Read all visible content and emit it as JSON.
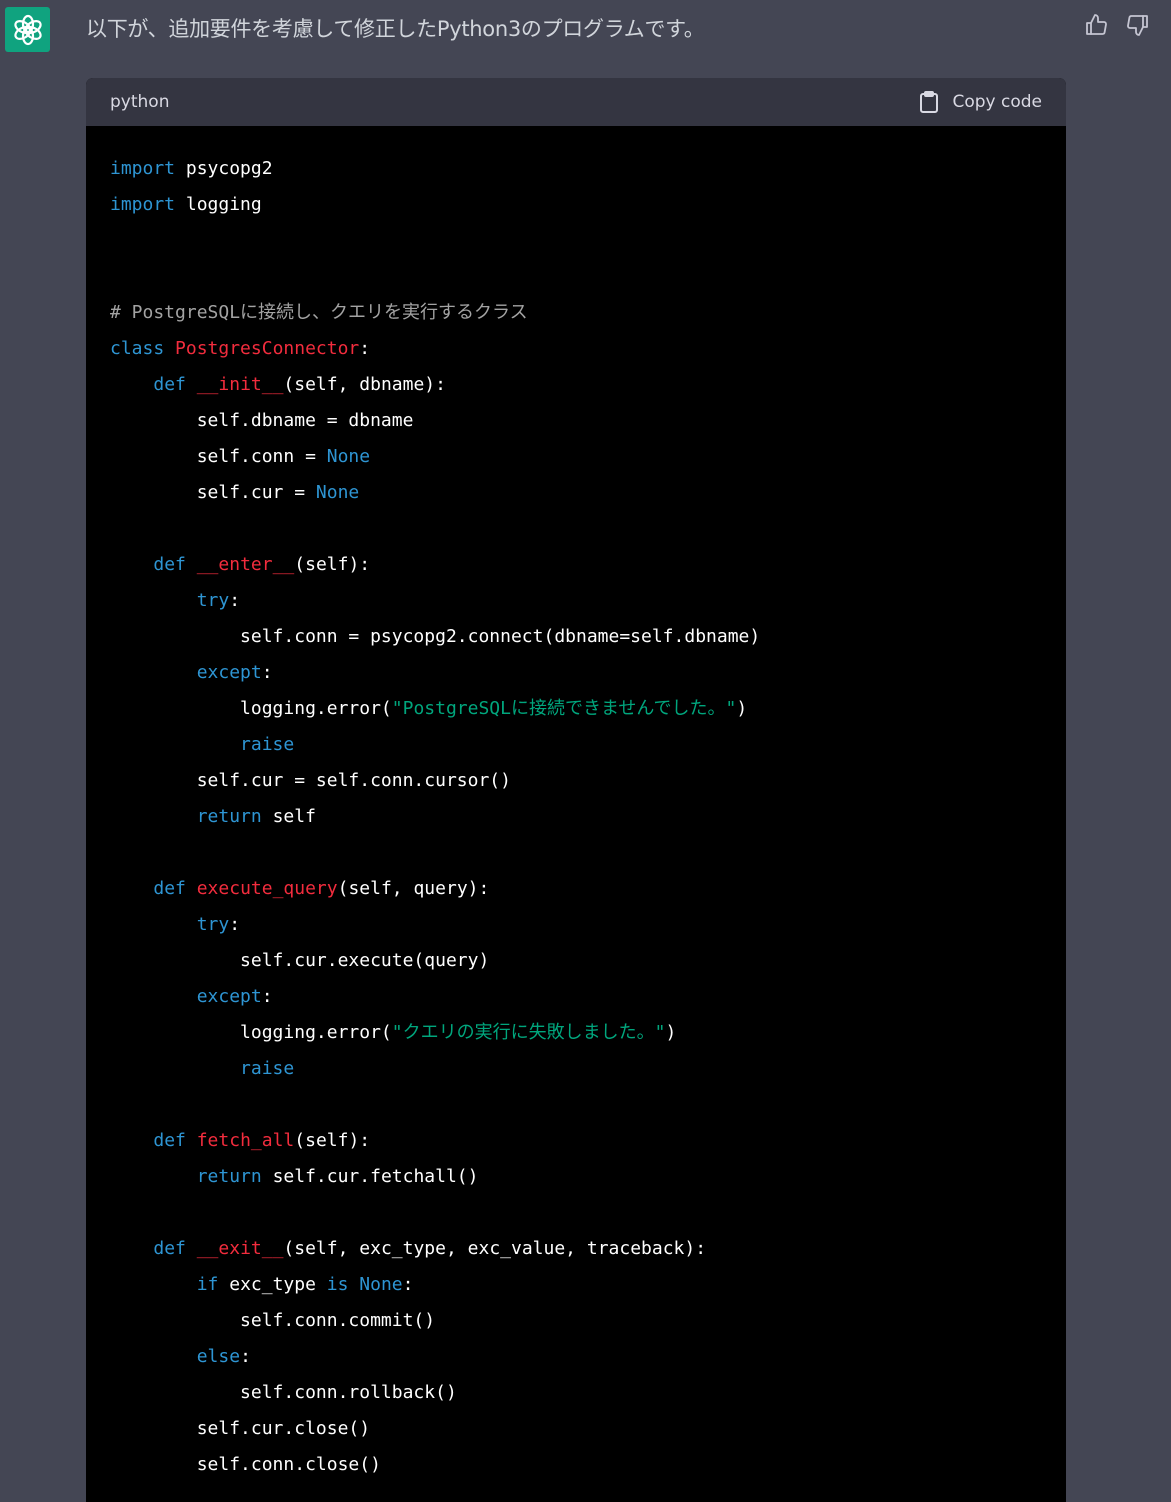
{
  "message": {
    "text": "以下が、追加要件を考慮して修正したPython3のプログラムです。"
  },
  "colors": {
    "background": "#444654",
    "avatar": "#10a37f",
    "code_header_bg": "#343541",
    "code_bg": "#000000",
    "keyword": "#2e95d3",
    "function": "#f22c3d",
    "string": "#00a67d",
    "comment": "#a3a3a3"
  },
  "icons": {
    "avatar": "openai-logo-icon",
    "thumbs_up": "thumbs-up-icon",
    "thumbs_down": "thumbs-down-icon",
    "copy": "clipboard-icon"
  },
  "code_block": {
    "language": "python",
    "copy_label": "Copy code",
    "lines": [
      [
        {
          "t": "import",
          "c": "kw"
        },
        {
          "t": " psycopg2"
        }
      ],
      [
        {
          "t": "import",
          "c": "kw"
        },
        {
          "t": " logging"
        }
      ],
      [],
      [],
      [
        {
          "t": "# PostgreSQLに接続し、クエリを実行するクラス",
          "c": "cm"
        }
      ],
      [
        {
          "t": "class",
          "c": "kw"
        },
        {
          "t": " "
        },
        {
          "t": "PostgresConnector",
          "c": "fn"
        },
        {
          "t": ":"
        }
      ],
      [
        {
          "t": "    "
        },
        {
          "t": "def",
          "c": "kw"
        },
        {
          "t": " "
        },
        {
          "t": "__init__",
          "c": "fn"
        },
        {
          "t": "(self, dbname):"
        }
      ],
      [
        {
          "t": "        self.dbname = dbname"
        }
      ],
      [
        {
          "t": "        self.conn = "
        },
        {
          "t": "None",
          "c": "kw"
        }
      ],
      [
        {
          "t": "        self.cur = "
        },
        {
          "t": "None",
          "c": "kw"
        }
      ],
      [],
      [
        {
          "t": "    "
        },
        {
          "t": "def",
          "c": "kw"
        },
        {
          "t": " "
        },
        {
          "t": "__enter__",
          "c": "fn"
        },
        {
          "t": "(self):"
        }
      ],
      [
        {
          "t": "        "
        },
        {
          "t": "try",
          "c": "kw"
        },
        {
          "t": ":"
        }
      ],
      [
        {
          "t": "            self.conn = psycopg2.connect(dbname=self.dbname)"
        }
      ],
      [
        {
          "t": "        "
        },
        {
          "t": "except",
          "c": "kw"
        },
        {
          "t": ":"
        }
      ],
      [
        {
          "t": "            logging.error("
        },
        {
          "t": "\"PostgreSQLに接続できませんでした。\"",
          "c": "str"
        },
        {
          "t": ")"
        }
      ],
      [
        {
          "t": "            "
        },
        {
          "t": "raise",
          "c": "kw"
        }
      ],
      [
        {
          "t": "        self.cur = self.conn.cursor()"
        }
      ],
      [
        {
          "t": "        "
        },
        {
          "t": "return",
          "c": "kw"
        },
        {
          "t": " self"
        }
      ],
      [],
      [
        {
          "t": "    "
        },
        {
          "t": "def",
          "c": "kw"
        },
        {
          "t": " "
        },
        {
          "t": "execute_query",
          "c": "fn"
        },
        {
          "t": "(self, query):"
        }
      ],
      [
        {
          "t": "        "
        },
        {
          "t": "try",
          "c": "kw"
        },
        {
          "t": ":"
        }
      ],
      [
        {
          "t": "            self.cur.execute(query)"
        }
      ],
      [
        {
          "t": "        "
        },
        {
          "t": "except",
          "c": "kw"
        },
        {
          "t": ":"
        }
      ],
      [
        {
          "t": "            logging.error("
        },
        {
          "t": "\"クエリの実行に失敗しました。\"",
          "c": "str"
        },
        {
          "t": ")"
        }
      ],
      [
        {
          "t": "            "
        },
        {
          "t": "raise",
          "c": "kw"
        }
      ],
      [],
      [
        {
          "t": "    "
        },
        {
          "t": "def",
          "c": "kw"
        },
        {
          "t": " "
        },
        {
          "t": "fetch_all",
          "c": "fn"
        },
        {
          "t": "(self):"
        }
      ],
      [
        {
          "t": "        "
        },
        {
          "t": "return",
          "c": "kw"
        },
        {
          "t": " self.cur.fetchall()"
        }
      ],
      [],
      [
        {
          "t": "    "
        },
        {
          "t": "def",
          "c": "kw"
        },
        {
          "t": " "
        },
        {
          "t": "__exit__",
          "c": "fn"
        },
        {
          "t": "(self, exc_type, exc_value, traceback):"
        }
      ],
      [
        {
          "t": "        "
        },
        {
          "t": "if",
          "c": "kw"
        },
        {
          "t": " exc_type "
        },
        {
          "t": "is",
          "c": "kw"
        },
        {
          "t": " "
        },
        {
          "t": "None",
          "c": "kw"
        },
        {
          "t": ":"
        }
      ],
      [
        {
          "t": "            self.conn.commit()"
        }
      ],
      [
        {
          "t": "        "
        },
        {
          "t": "else",
          "c": "kw"
        },
        {
          "t": ":"
        }
      ],
      [
        {
          "t": "            self.conn.rollback()"
        }
      ],
      [
        {
          "t": "        self.cur.close()"
        }
      ],
      [
        {
          "t": "        self.conn.close()"
        }
      ]
    ]
  }
}
